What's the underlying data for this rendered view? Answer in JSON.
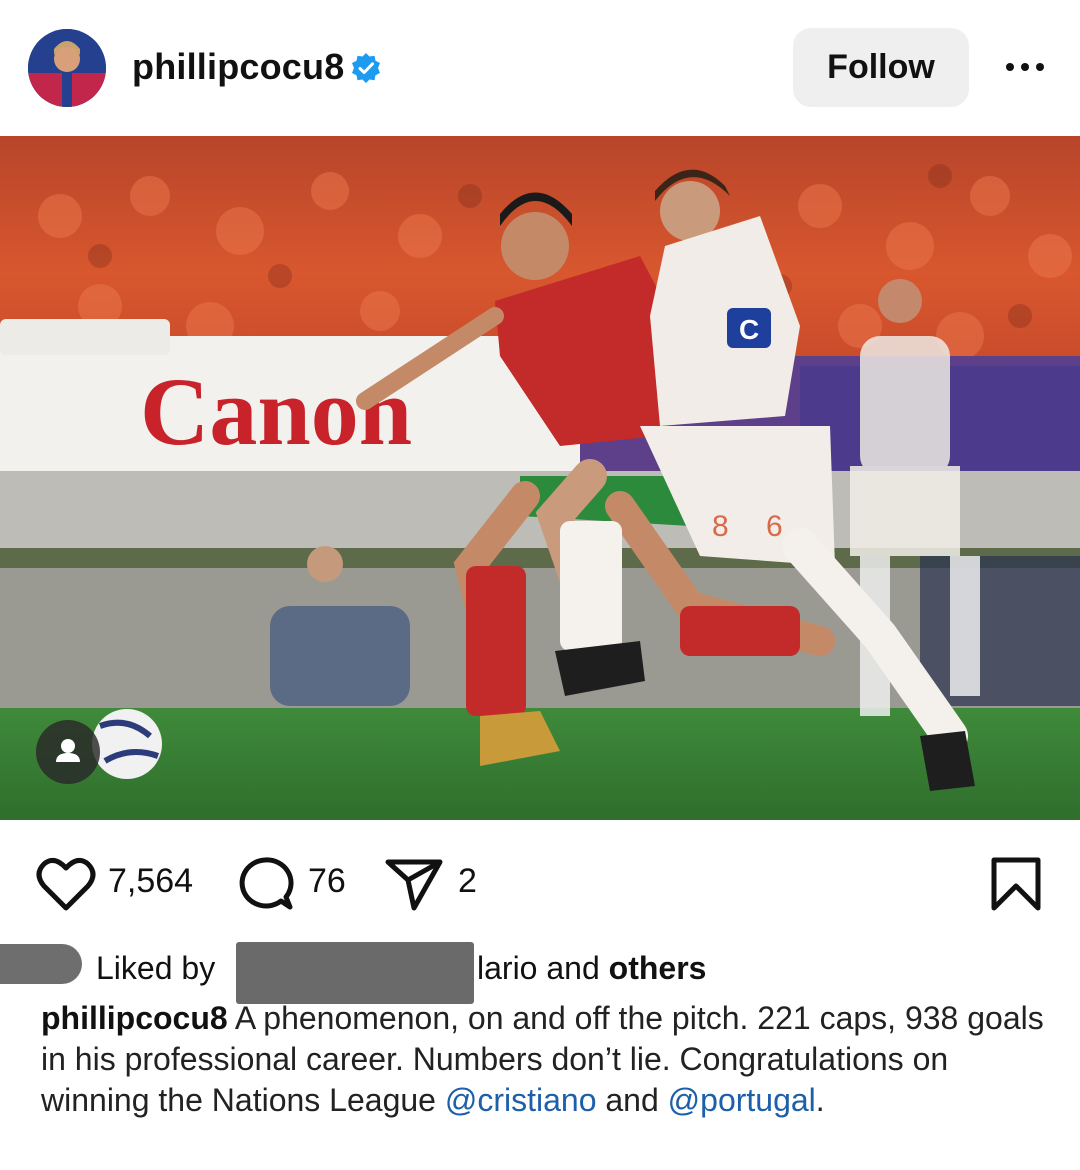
{
  "post": {
    "username": "phillipcocu8",
    "follow_label": "Follow",
    "likes_count": "7,564",
    "comments_count": "76",
    "shares_count": "2",
    "liked_by": {
      "prefix": "Liked by",
      "suffix": "lario and",
      "others": "others"
    },
    "caption": {
      "user": "phillipcocu8",
      "text_1": " A phenomenon, on and off the pitch. 221 caps, 938 goals in his professional career. Numbers don’t lie. Congratulations on winning the Nations League ",
      "mention_1": "@cristiano",
      "text_2": " and ",
      "mention_2": "@portugal",
      "text_3": "."
    }
  },
  "photo": {
    "banner_text": "Canon",
    "captain_band": "C",
    "shirt_number_1": "8",
    "shirt_number_2": "6"
  },
  "icons": {
    "verified": "verified-badge-icon",
    "more": "more-options-icon",
    "tag": "person-tag-icon",
    "like": "heart-icon",
    "comment": "comment-icon",
    "share": "share-icon",
    "save": "bookmark-icon"
  },
  "colors": {
    "verified_blue": "#1d9bf0",
    "mention_blue": "#1d5fa8",
    "follow_bg": "#efefef"
  }
}
